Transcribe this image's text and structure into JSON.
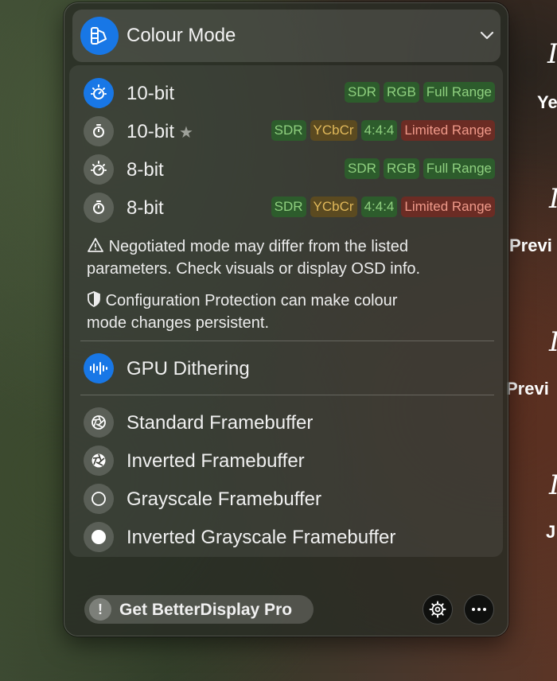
{
  "background_fragments": [
    "Ye",
    "Previ",
    "Previ",
    "J"
  ],
  "panel": {
    "title": "Colour Mode",
    "modes": [
      {
        "label": "10-bit",
        "starred": false,
        "active": true,
        "tags": [
          {
            "text": "SDR",
            "color": "green"
          },
          {
            "text": "RGB",
            "color": "green"
          },
          {
            "text": "Full Range",
            "color": "green"
          }
        ]
      },
      {
        "label": "10-bit",
        "starred": true,
        "active": false,
        "tags": [
          {
            "text": "SDR",
            "color": "green"
          },
          {
            "text": "YCbCr",
            "color": "brown"
          },
          {
            "text": "4:4:4",
            "color": "green"
          },
          {
            "text": "Limited Range",
            "color": "red"
          }
        ]
      },
      {
        "label": "8-bit",
        "starred": false,
        "active": false,
        "tags": [
          {
            "text": "SDR",
            "color": "green"
          },
          {
            "text": "RGB",
            "color": "green"
          },
          {
            "text": "Full Range",
            "color": "green"
          }
        ]
      },
      {
        "label": "8-bit",
        "starred": false,
        "active": false,
        "tags": [
          {
            "text": "SDR",
            "color": "green"
          },
          {
            "text": "YCbCr",
            "color": "brown"
          },
          {
            "text": "4:4:4",
            "color": "green"
          },
          {
            "text": "Limited Range",
            "color": "red"
          }
        ]
      }
    ],
    "star_glyph": "★",
    "warning_note": {
      "icon": "warning-icon",
      "line1": "Negotiated mode may differ from the listed",
      "line2": "parameters. Check visuals or display OSD info."
    },
    "protection_note": {
      "icon": "shield-icon",
      "line1": "Configuration Protection can make colour",
      "line2": "mode changes persistent."
    },
    "gpu_dithering_label": "GPU Dithering",
    "framebuffers": [
      {
        "label": "Standard Framebuffer",
        "icon": "aperture-icon"
      },
      {
        "label": "Inverted Framebuffer",
        "icon": "aperture-inverted-icon"
      },
      {
        "label": "Grayscale Framebuffer",
        "icon": "circle-outline-icon"
      },
      {
        "label": "Inverted Grayscale Framebuffer",
        "icon": "circle-filled-icon"
      }
    ]
  },
  "footer": {
    "pro_icon_glyph": "!",
    "pro_label": "Get BetterDisplay Pro",
    "settings_icon": "gear-icon",
    "more_icon": "ellipsis-icon"
  },
  "colors": {
    "accent": "#1877e6",
    "tag_green_bg": "#2d5c2c",
    "tag_brown_bg": "#5b4a20",
    "tag_red_bg": "#6b2c24"
  }
}
